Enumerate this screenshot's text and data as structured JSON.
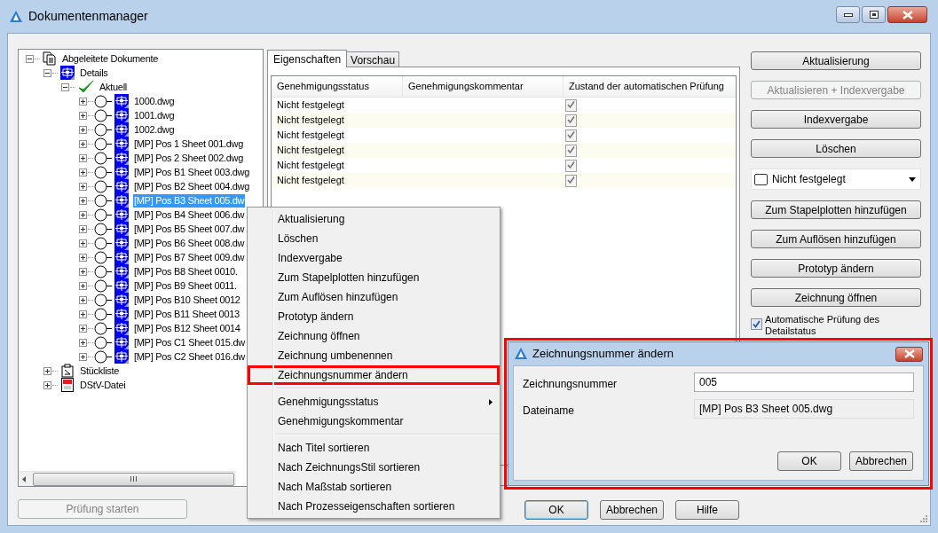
{
  "window": {
    "title": "Dokumentenmanager"
  },
  "tree": {
    "nodes": [
      {
        "label": "Abgeleitete Dokumente",
        "kind": "documents",
        "expanded": true,
        "selected": false,
        "children": [
          {
            "label": "Details",
            "kind": "detail",
            "expanded": true,
            "selected": false,
            "children": [
              {
                "label": "Aktuell",
                "kind": "check",
                "expanded": true,
                "selected": false,
                "children": [
                  {
                    "label": "1000.dwg",
                    "kind": "file",
                    "expanded": false,
                    "selected": false
                  },
                  {
                    "label": "1001.dwg",
                    "kind": "file",
                    "expanded": false,
                    "selected": false
                  },
                  {
                    "label": "1002.dwg",
                    "kind": "file",
                    "expanded": false,
                    "selected": false
                  },
                  {
                    "label": "[MP] Pos 1 Sheet 001.dwg",
                    "kind": "file",
                    "expanded": false,
                    "selected": false
                  },
                  {
                    "label": "[MP] Pos 2 Sheet 002.dwg",
                    "kind": "file",
                    "expanded": false,
                    "selected": false
                  },
                  {
                    "label": "[MP] Pos B1 Sheet 003.dwg",
                    "kind": "file",
                    "expanded": false,
                    "selected": false
                  },
                  {
                    "label": "[MP] Pos B2 Sheet 004.dwg",
                    "kind": "file",
                    "expanded": false,
                    "selected": false
                  },
                  {
                    "label": "[MP] Pos B3 Sheet 005.dw",
                    "kind": "file",
                    "expanded": false,
                    "selected": true
                  },
                  {
                    "label": "[MP] Pos B4 Sheet 006.dw",
                    "kind": "file",
                    "expanded": false,
                    "selected": false
                  },
                  {
                    "label": "[MP] Pos B5 Sheet 007.dw",
                    "kind": "file",
                    "expanded": false,
                    "selected": false
                  },
                  {
                    "label": "[MP] Pos B6 Sheet 008.dw",
                    "kind": "file",
                    "expanded": false,
                    "selected": false
                  },
                  {
                    "label": "[MP] Pos B7 Sheet 009.dw",
                    "kind": "file",
                    "expanded": false,
                    "selected": false
                  },
                  {
                    "label": "[MP] Pos B8 Sheet 0010.",
                    "kind": "file",
                    "expanded": false,
                    "selected": false
                  },
                  {
                    "label": "[MP] Pos B9 Sheet 0011.",
                    "kind": "file",
                    "expanded": false,
                    "selected": false
                  },
                  {
                    "label": "[MP] Pos B10 Sheet 0012",
                    "kind": "file",
                    "expanded": false,
                    "selected": false
                  },
                  {
                    "label": "[MP] Pos B11 Sheet 0013",
                    "kind": "file",
                    "expanded": false,
                    "selected": false
                  },
                  {
                    "label": "[MP] Pos B12 Sheet 0014",
                    "kind": "file",
                    "expanded": false,
                    "selected": false
                  },
                  {
                    "label": "[MP] Pos C1 Sheet 015.dw",
                    "kind": "file",
                    "expanded": false,
                    "selected": false
                  },
                  {
                    "label": "[MP] Pos C2 Sheet 016.dw",
                    "kind": "file",
                    "expanded": false,
                    "selected": false
                  }
                ]
              }
            ]
          },
          {
            "label": "Stückliste",
            "kind": "list",
            "expanded": false,
            "selected": false
          },
          {
            "label": "DStV-Datei",
            "kind": "doc",
            "expanded": false,
            "selected": false
          }
        ]
      }
    ]
  },
  "check_button": {
    "label": "Prüfung starten",
    "disabled": true
  },
  "tabs": [
    {
      "label": "Eigenschaften",
      "selected": true
    },
    {
      "label": "Vorschau",
      "selected": false
    }
  ],
  "grid": {
    "columns": [
      "Genehmigungsstatus",
      "Genehmigungskommentar",
      "Zustand der automatischen Prüfung"
    ],
    "rows": [
      {
        "status": "Nicht festgelegt",
        "checked": true
      },
      {
        "status": "Nicht festgelegt",
        "checked": true
      },
      {
        "status": "Nicht festgelegt",
        "checked": true
      },
      {
        "status": "Nicht festgelegt",
        "checked": true
      },
      {
        "status": "Nicht festgelegt",
        "checked": true
      },
      {
        "status": "Nicht festgelegt",
        "checked": true
      }
    ]
  },
  "right_panel": [
    {
      "kind": "button",
      "label": "Aktualisierung",
      "disabled": false
    },
    {
      "kind": "button",
      "label": "Aktualisieren + Indexvergabe",
      "disabled": true
    },
    {
      "kind": "button",
      "label": "Indexvergabe",
      "disabled": false
    },
    {
      "kind": "button",
      "label": "Löschen",
      "disabled": false
    },
    {
      "kind": "dropdown",
      "label": "Nicht festgelegt",
      "color": "#ffffff"
    },
    {
      "kind": "button",
      "label": "Zum Stapelplotten hinzufügen",
      "disabled": false
    },
    {
      "kind": "button",
      "label": "Zum Auflösen hinzufügen",
      "disabled": false
    },
    {
      "kind": "button",
      "label": "Prototyp ändern",
      "disabled": false
    },
    {
      "kind": "button",
      "label": "Zeichnung öffnen",
      "disabled": false
    },
    {
      "kind": "checkbox",
      "label": "Automatische Prüfung des Detailstatus",
      "checked": true
    }
  ],
  "footer_buttons": [
    {
      "label": "OK",
      "default": true
    },
    {
      "label": "Abbrechen",
      "default": false
    },
    {
      "label": "Hilfe",
      "default": false
    }
  ],
  "context_menu": {
    "groups": [
      [
        {
          "label": "Aktualisierung",
          "submenu": false,
          "highlighted": false
        },
        {
          "label": "Löschen",
          "submenu": false,
          "highlighted": false
        },
        {
          "label": "Indexvergabe",
          "submenu": false,
          "highlighted": false
        },
        {
          "label": "Zum Stapelplotten hinzufügen",
          "submenu": false,
          "highlighted": false
        },
        {
          "label": "Zum Auflösen hinzufügen",
          "submenu": false,
          "highlighted": false
        },
        {
          "label": "Prototyp ändern",
          "submenu": false,
          "highlighted": false
        },
        {
          "label": "Zeichnung öffnen",
          "submenu": false,
          "highlighted": false
        },
        {
          "label": "Zeichnung umbenennen",
          "submenu": false,
          "highlighted": false
        },
        {
          "label": "Zeichnungsnummer ändern",
          "submenu": false,
          "highlighted": true
        }
      ],
      [
        {
          "label": "Genehmigungsstatus",
          "submenu": true,
          "highlighted": false
        },
        {
          "label": "Genehmigungskommentar",
          "submenu": false,
          "highlighted": false
        }
      ],
      [
        {
          "label": "Nach Titel sortieren",
          "submenu": false,
          "highlighted": false
        },
        {
          "label": "Nach ZeichnungsStil sortieren",
          "submenu": false,
          "highlighted": false
        },
        {
          "label": "Nach Maßstab sortieren",
          "submenu": false,
          "highlighted": false
        },
        {
          "label": "Nach Prozesseigenschaften sortieren",
          "submenu": false,
          "highlighted": false
        }
      ]
    ]
  },
  "dialog": {
    "title": "Zeichnungsnummer ändern",
    "highlighted": true,
    "fields": [
      {
        "label": "Zeichnungsnummer",
        "value": "005",
        "kind": "input"
      },
      {
        "label": "Dateiname",
        "value": "[MP] Pos B3 Sheet 005.dwg",
        "kind": "readonly"
      }
    ],
    "buttons": [
      "OK",
      "Abbrechen"
    ]
  }
}
